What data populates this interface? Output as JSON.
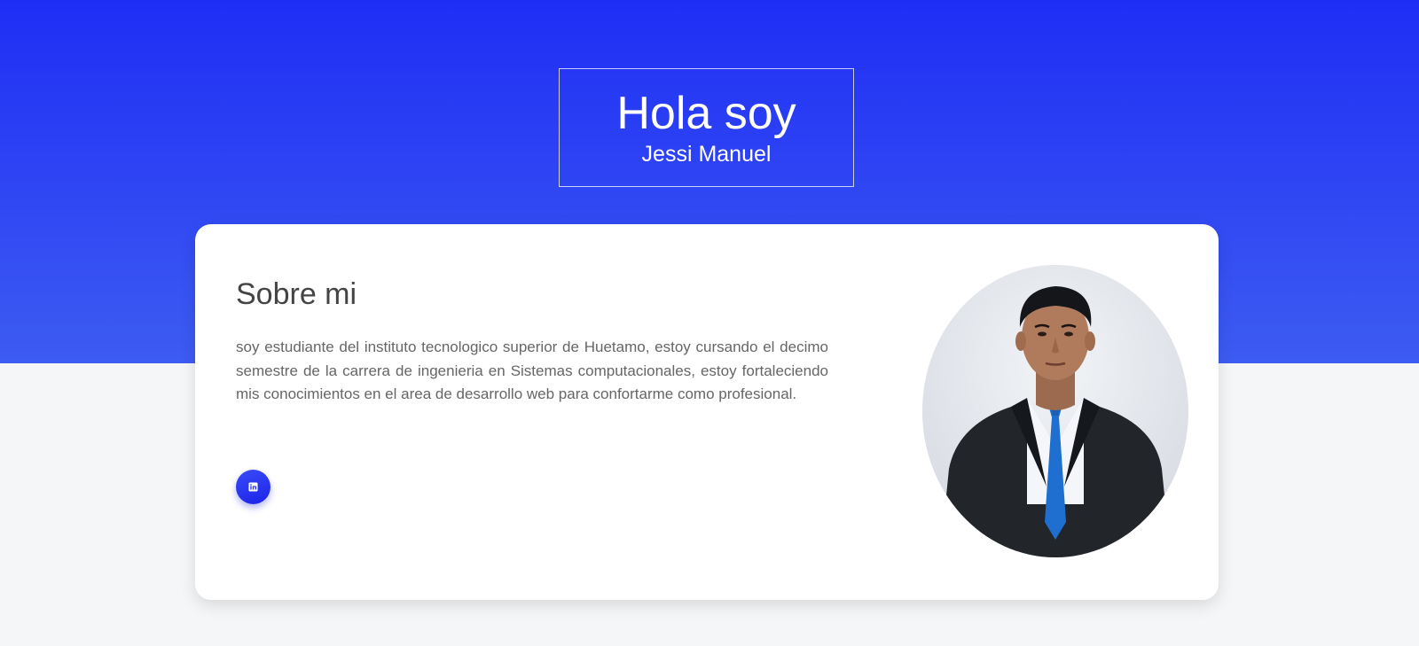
{
  "hero": {
    "title": "Hola soy",
    "subtitle": "Jessi Manuel"
  },
  "about": {
    "heading": "Sobre mi",
    "text": "soy estudiante del instituto tecnologico superior de Huetamo, estoy cursando el decimo semestre de la carrera de ingenieria en Sistemas computacionales, estoy fortaleciendo mis conocimientos en el area de desarrollo web para confortarme como profesional."
  },
  "social": {
    "icon": "linkedin-icon"
  },
  "colors": {
    "hero_gradient_top": "#1f2ef5",
    "hero_gradient_bottom": "#3d5cf2",
    "page_background": "#f5f6f8",
    "card_background": "#ffffff",
    "button_accent": "#1a22e8"
  }
}
